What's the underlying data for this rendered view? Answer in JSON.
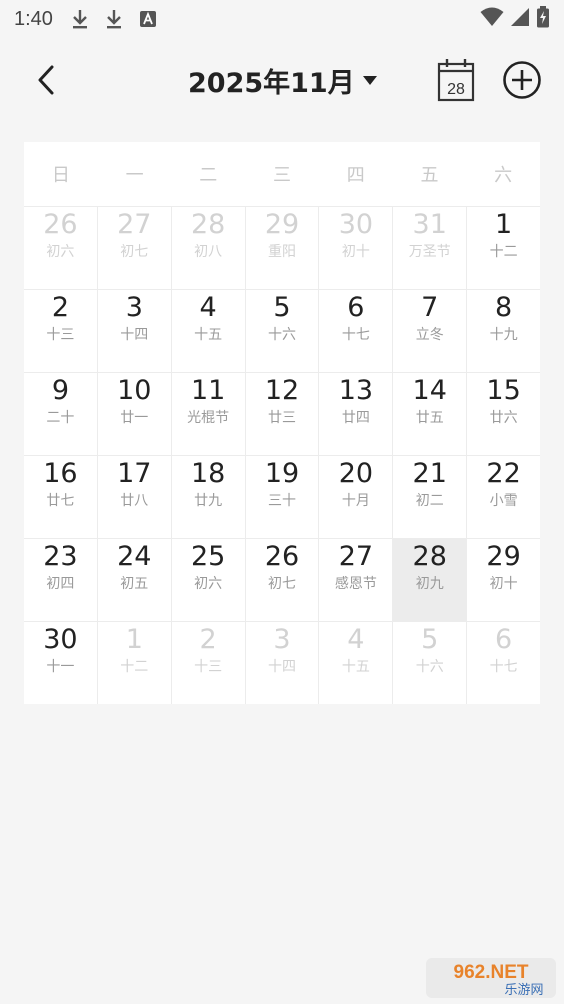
{
  "status_bar": {
    "time": "1:40",
    "icons": [
      "download-icon",
      "download-icon",
      "font-app-icon"
    ],
    "right_icons": [
      "wifi-icon",
      "signal-icon",
      "battery-charging-icon"
    ]
  },
  "header": {
    "title": "2025年11月",
    "calendar_icon_day": "28"
  },
  "calendar": {
    "weekdays": [
      "日",
      "一",
      "二",
      "三",
      "四",
      "五",
      "六"
    ],
    "weeks": [
      [
        {
          "num": "26",
          "lunar": "初六",
          "muted": true
        },
        {
          "num": "27",
          "lunar": "初七",
          "muted": true
        },
        {
          "num": "28",
          "lunar": "初八",
          "muted": true
        },
        {
          "num": "29",
          "lunar": "重阳",
          "muted": true
        },
        {
          "num": "30",
          "lunar": "初十",
          "muted": true
        },
        {
          "num": "31",
          "lunar": "万圣节",
          "muted": true
        },
        {
          "num": "1",
          "lunar": "十二",
          "muted": false
        }
      ],
      [
        {
          "num": "2",
          "lunar": "十三",
          "muted": false
        },
        {
          "num": "3",
          "lunar": "十四",
          "muted": false
        },
        {
          "num": "4",
          "lunar": "十五",
          "muted": false
        },
        {
          "num": "5",
          "lunar": "十六",
          "muted": false
        },
        {
          "num": "6",
          "lunar": "十七",
          "muted": false
        },
        {
          "num": "7",
          "lunar": "立冬",
          "muted": false
        },
        {
          "num": "8",
          "lunar": "十九",
          "muted": false
        }
      ],
      [
        {
          "num": "9",
          "lunar": "二十",
          "muted": false
        },
        {
          "num": "10",
          "lunar": "廿一",
          "muted": false
        },
        {
          "num": "11",
          "lunar": "光棍节",
          "muted": false
        },
        {
          "num": "12",
          "lunar": "廿三",
          "muted": false
        },
        {
          "num": "13",
          "lunar": "廿四",
          "muted": false
        },
        {
          "num": "14",
          "lunar": "廿五",
          "muted": false
        },
        {
          "num": "15",
          "lunar": "廿六",
          "muted": false
        }
      ],
      [
        {
          "num": "16",
          "lunar": "廿七",
          "muted": false
        },
        {
          "num": "17",
          "lunar": "廿八",
          "muted": false
        },
        {
          "num": "18",
          "lunar": "廿九",
          "muted": false
        },
        {
          "num": "19",
          "lunar": "三十",
          "muted": false
        },
        {
          "num": "20",
          "lunar": "十月",
          "muted": false
        },
        {
          "num": "21",
          "lunar": "初二",
          "muted": false
        },
        {
          "num": "22",
          "lunar": "小雪",
          "muted": false
        }
      ],
      [
        {
          "num": "23",
          "lunar": "初四",
          "muted": false
        },
        {
          "num": "24",
          "lunar": "初五",
          "muted": false
        },
        {
          "num": "25",
          "lunar": "初六",
          "muted": false
        },
        {
          "num": "26",
          "lunar": "初七",
          "muted": false
        },
        {
          "num": "27",
          "lunar": "感恩节",
          "muted": false
        },
        {
          "num": "28",
          "lunar": "初九",
          "muted": false,
          "selected": true
        },
        {
          "num": "29",
          "lunar": "初十",
          "muted": false
        }
      ],
      [
        {
          "num": "30",
          "lunar": "十一",
          "muted": false
        },
        {
          "num": "1",
          "lunar": "十二",
          "muted": true
        },
        {
          "num": "2",
          "lunar": "十三",
          "muted": true
        },
        {
          "num": "3",
          "lunar": "十四",
          "muted": true
        },
        {
          "num": "4",
          "lunar": "十五",
          "muted": true
        },
        {
          "num": "5",
          "lunar": "十六",
          "muted": true
        },
        {
          "num": "6",
          "lunar": "十七",
          "muted": true
        }
      ]
    ]
  },
  "watermark": {
    "brand": "962.NET",
    "sub": "乐游网"
  },
  "colors": {
    "background": "#f5f5f5",
    "card": "#ffffff",
    "selected_cell": "#ececec",
    "text_primary": "#222222",
    "text_lunar": "#9a9a9a",
    "text_muted": "#d2d2d2"
  }
}
